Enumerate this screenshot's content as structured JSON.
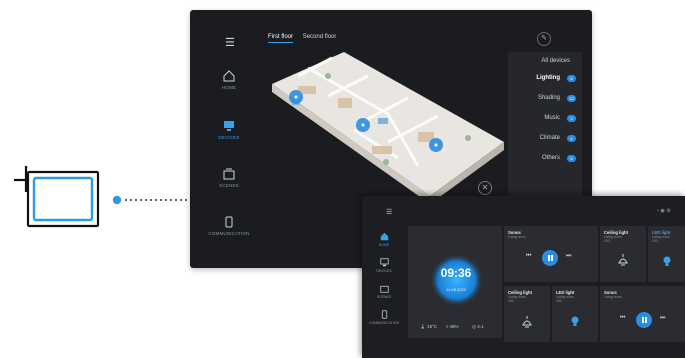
{
  "big_panel": {
    "nav": [
      {
        "icon": "home-icon",
        "label": "HOME",
        "active": false
      },
      {
        "icon": "devices-icon",
        "label": "DEVICES",
        "active": true
      },
      {
        "icon": "scenes-icon",
        "label": "SCENES",
        "active": false
      },
      {
        "icon": "communication-icon",
        "label": "COMMUNICATION",
        "active": false
      }
    ],
    "tabs": {
      "first": "First floor",
      "second": "Second floor"
    },
    "all_devices": "All devices",
    "categories": [
      {
        "label": "Lighting",
        "count": "8",
        "active": true
      },
      {
        "label": "Shading",
        "count": "12",
        "active": false
      },
      {
        "label": "Music",
        "count": "3",
        "active": false
      },
      {
        "label": "Climate",
        "count": "4",
        "active": false
      },
      {
        "label": "Others",
        "count": "5",
        "active": false
      }
    ],
    "close_glyph": "✕",
    "edit_glyph": "✎"
  },
  "small_panel": {
    "nav": [
      {
        "icon": "home-icon",
        "label": "HOME",
        "active": true
      },
      {
        "icon": "devices-icon",
        "label": "DEVICES",
        "active": false
      },
      {
        "icon": "scenes-icon",
        "label": "SCENES",
        "active": false
      },
      {
        "icon": "communication-icon",
        "label": "COMMUNICATION",
        "active": false
      }
    ],
    "clock": {
      "time": "09:36",
      "date": "14.08.2020"
    },
    "stats": {
      "temp": "19°C",
      "humidity": "48%",
      "air": "2.1"
    },
    "cards": {
      "sonos1": {
        "title": "Sonos",
        "sub": "Living room"
      },
      "ceiling1": {
        "title": "Ceiling light",
        "sub": "Living room\n100"
      },
      "led1": {
        "title": "LED light",
        "sub": "Living room\n100"
      },
      "ceiling2": {
        "title": "Ceiling light",
        "sub": "Living room\n100"
      },
      "led2": {
        "title": "LED light",
        "sub": "Living room\n100"
      },
      "sonos2": {
        "title": "Sonos",
        "sub": "Living room"
      }
    }
  },
  "colors": {
    "accent": "#2b8de0",
    "panel": "#1b1c1f",
    "card": "#2a2c31"
  }
}
